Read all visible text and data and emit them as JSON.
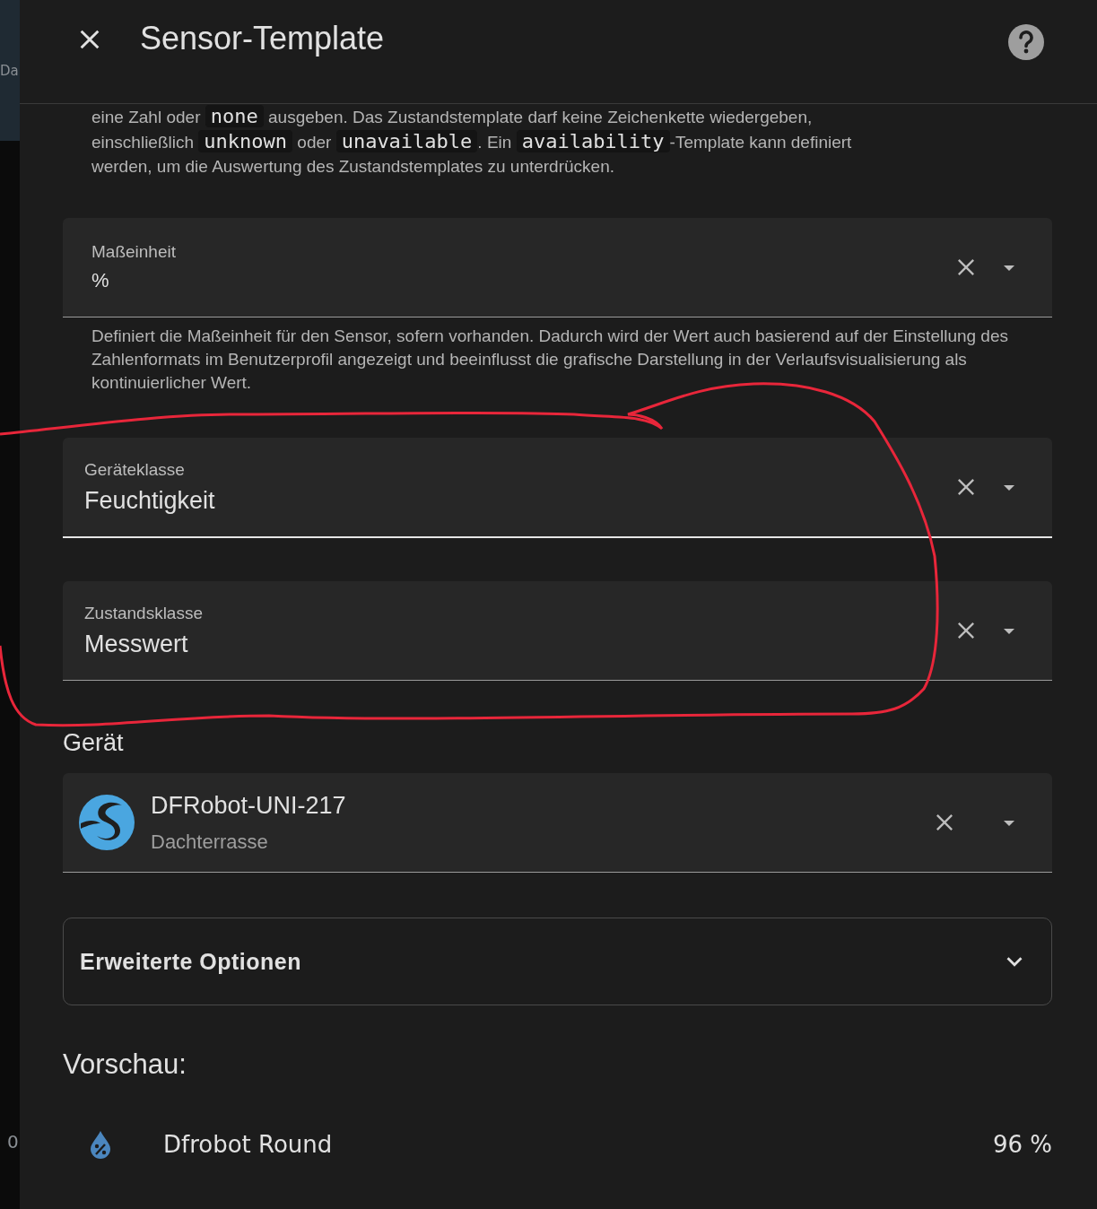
{
  "background_page": {
    "texts": [
      "Da",
      "0"
    ]
  },
  "dialog": {
    "title": "Sensor-Template"
  },
  "intro_lines": [
    [
      {
        "kind": "text",
        "text": "eine Zahl oder "
      },
      {
        "kind": "code",
        "text": "none"
      },
      {
        "kind": "text",
        "text": " ausgeben. Das Zustandstemplate darf keine Zeichenkette wiedergeben,"
      }
    ],
    [
      {
        "kind": "text",
        "text": "einschließlich "
      },
      {
        "kind": "code",
        "text": "unknown"
      },
      {
        "kind": "text",
        "text": " oder "
      },
      {
        "kind": "code",
        "text": "unavailable"
      },
      {
        "kind": "text",
        "text": ". Ein "
      },
      {
        "kind": "code",
        "text": "availability"
      },
      {
        "kind": "text",
        "text": "-Template kann definiert"
      }
    ],
    [
      {
        "kind": "text",
        "text": "werden, um die Auswertung des Zustandstemplates zu unterdrücken."
      }
    ]
  ],
  "fields": [
    {
      "kind": "combobox",
      "label": "Maßeinheit",
      "value": "%",
      "helper": "Definiert die Maßeinheit für den Sensor, sofern vorhanden. Dadurch wird der Wert auch basierend auf der Einstellung des Zahlenformats im Benutzerprofil angezeigt und beeinflusst die grafische Darstellung in der Verlaufsvisualisierung als kontinuierlicher Wert."
    },
    {
      "kind": "select",
      "label": "Geräteklasse",
      "value": "Feuchtigkeit"
    },
    {
      "kind": "select",
      "label": "Zustandsklasse",
      "value": "Messwert"
    }
  ],
  "device": {
    "heading": "Gerät",
    "name": "DFRobot-UNI-217",
    "area": "Dachterrasse"
  },
  "advanced": {
    "title": "Erweiterte Optionen",
    "expanded": false
  },
  "preview": {
    "heading": "Vorschau:",
    "entity": "Dfrobot Round",
    "state": "96 %"
  }
}
